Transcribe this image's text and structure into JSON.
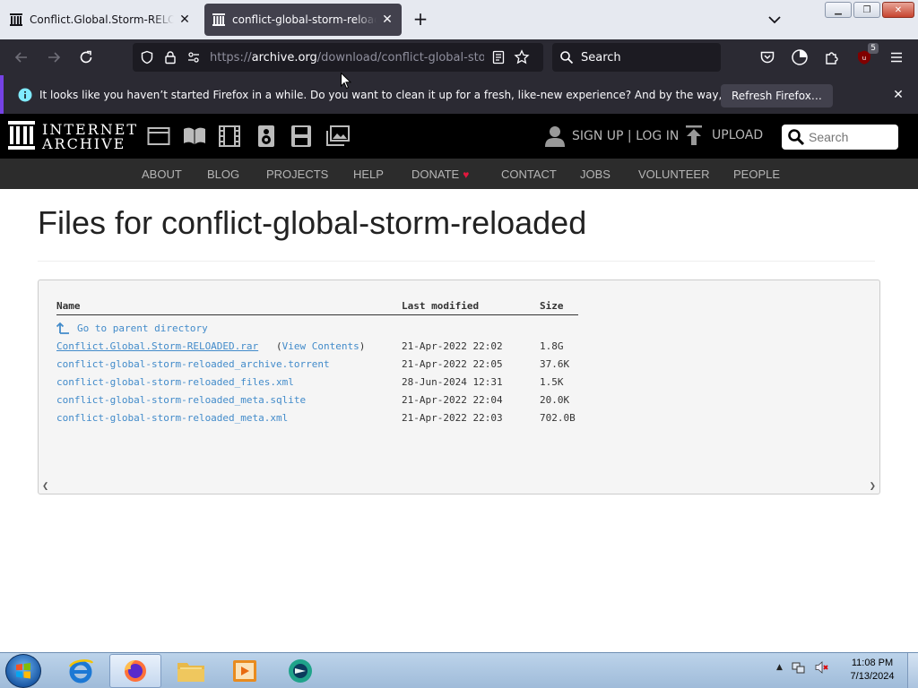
{
  "browser": {
    "tabs": [
      {
        "title": "Conflict.Global.Storm-RELOADED.rar"
      },
      {
        "title": "conflict-global-storm-reloaded"
      }
    ],
    "url_prefix": "https://",
    "url_host": "archive.org",
    "url_path": "/download/conflict-global-storm-reloaded",
    "search_label": "Search",
    "extension_badge": "5"
  },
  "notification": {
    "message": "It looks like you haven’t started Firefox in a while. Do you want to clean it up for a fresh, like-new experience? And by the way, welcome back!",
    "button_label": "Refresh Firefox…"
  },
  "site": {
    "logo_line1": "INTERNET",
    "logo_line2": "ARCHIVE",
    "signup_label": "SIGN UP | LOG IN",
    "upload_label": "UPLOAD",
    "search_placeholder": "Search",
    "menu": [
      "ABOUT",
      "BLOG",
      "PROJECTS",
      "HELP",
      "DONATE",
      "CONTACT",
      "JOBS",
      "VOLUNTEER",
      "PEOPLE"
    ]
  },
  "page": {
    "title": "Files for conflict-global-storm-reloaded",
    "columns": {
      "name": "Name",
      "modified": "Last modified",
      "size": "Size"
    },
    "parent_label": "Go to parent directory",
    "view_contents_open": "(",
    "view_contents_label": "View Contents",
    "view_contents_close": ")",
    "files": [
      {
        "name": "Conflict.Global.Storm-RELOADED.rar",
        "modified": "21-Apr-2022 22:02",
        "size": "1.8G"
      },
      {
        "name": "conflict-global-storm-reloaded_archive.torrent",
        "modified": "21-Apr-2022 22:05",
        "size": "37.6K"
      },
      {
        "name": "conflict-global-storm-reloaded_files.xml",
        "modified": "28-Jun-2024 12:31",
        "size": "1.5K"
      },
      {
        "name": "conflict-global-storm-reloaded_meta.sqlite",
        "modified": "21-Apr-2022 22:04",
        "size": "20.0K"
      },
      {
        "name": "conflict-global-storm-reloaded_meta.xml",
        "modified": "21-Apr-2022 22:03",
        "size": "702.0B"
      }
    ]
  },
  "taskbar": {
    "time": "11:08 PM",
    "date": "7/13/2024"
  }
}
